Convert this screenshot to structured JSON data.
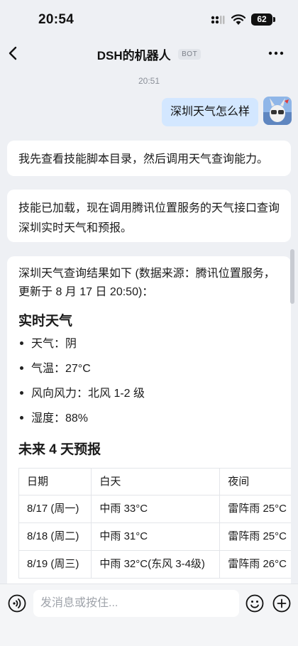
{
  "status_bar": {
    "time": "20:54",
    "battery": "62"
  },
  "nav": {
    "title": "DSH的机器人",
    "badge": "BOT"
  },
  "timestamp": "20:51",
  "user_message": "深圳天气怎么样",
  "bot_messages": {
    "m1": "我先查看技能脚本目录，然后调用天气查询能力。",
    "m2": "技能已加载，现在调用腾讯位置服务的天气接口查询深圳实时天气和预报。",
    "m3": {
      "intro": "深圳天气查询结果如下 (数据来源：腾讯位置服务，更新于 8 月 17 日 20:50)：",
      "realtime_heading": "实时天气",
      "realtime": [
        "天气：阴",
        "气温：27°C",
        "风向风力：北风 1-2 级",
        "湿度：88%"
      ],
      "forecast_heading": "未来 4 天预报",
      "forecast_columns": [
        "日期",
        "白天",
        "夜间"
      ],
      "forecast_rows": [
        [
          "8/17 (周一)",
          "中雨 33°C",
          "雷阵雨 25°C"
        ],
        [
          "8/18 (周二)",
          "中雨 31°C",
          "雷阵雨 25°C"
        ],
        [
          "8/19 (周三)",
          "中雨 32°C(东风 3-4级)",
          "雷阵雨 26°C"
        ]
      ]
    }
  },
  "input": {
    "placeholder": "发消息或按住..."
  },
  "icons": {
    "back": "chevron-left-icon",
    "more": "more-icon",
    "voice": "voice-icon",
    "emoji": "emoji-icon",
    "plus": "plus-icon"
  },
  "colors": {
    "user_bubble": "#d3e7ff",
    "background": "#eef0f4",
    "bubble": "#ffffff"
  }
}
